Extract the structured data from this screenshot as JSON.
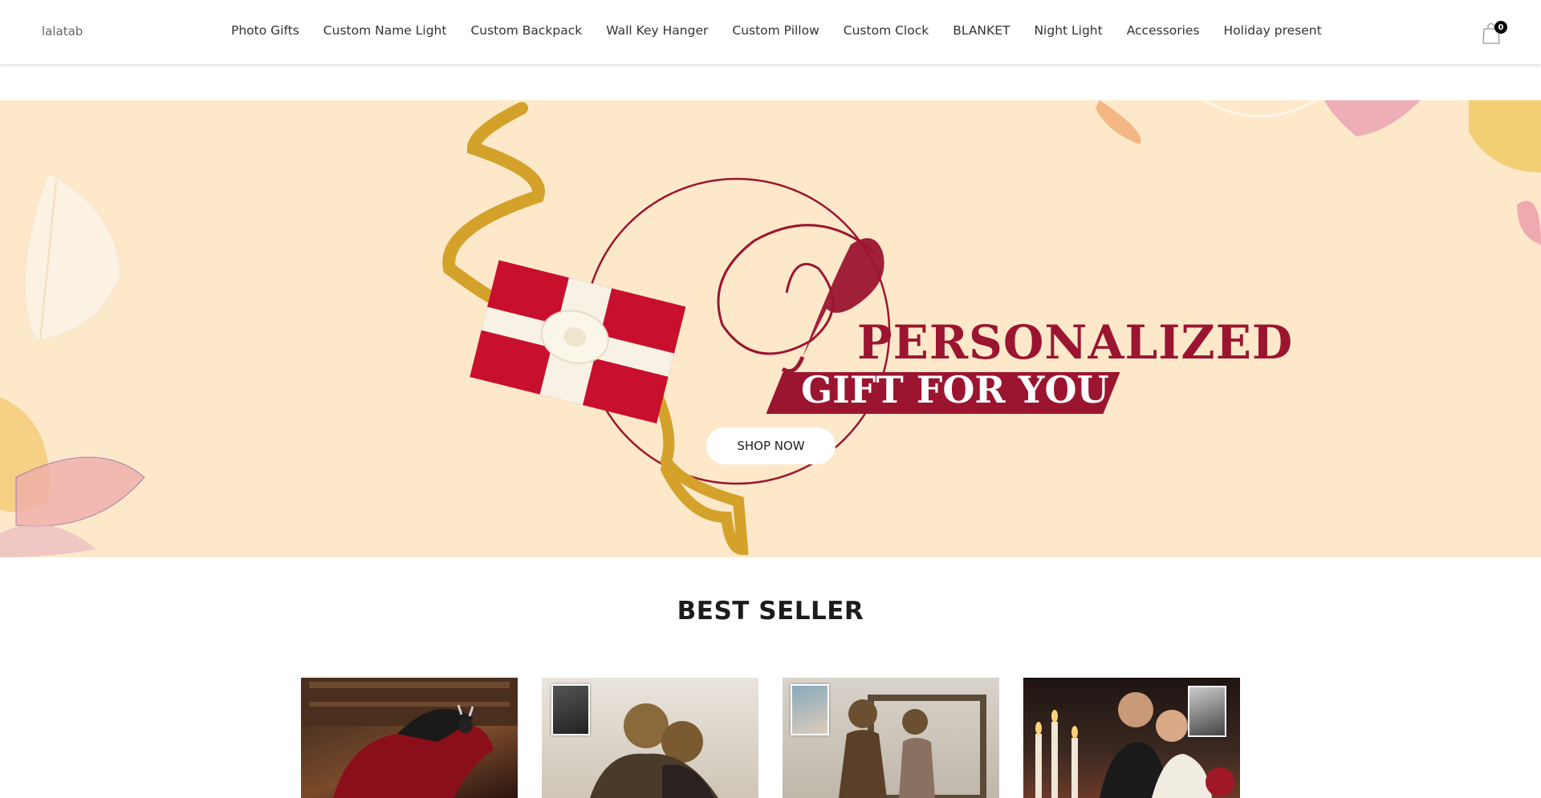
{
  "header": {
    "logo": "lalatab",
    "nav": [
      "Photo Gifts",
      "Custom Name Light",
      "Custom Backpack",
      "Wall Key Hanger",
      "Custom Pillow",
      "Custom Clock",
      "BLANKET",
      "Night Light",
      "Accessories",
      "Holiday present"
    ],
    "cart_count": "0",
    "cart_icon": "shopping-bag-icon"
  },
  "hero": {
    "title": "PERSONALIZED",
    "subtitle": "GIFT FOR YOU",
    "button": "SHOP NOW",
    "colors": {
      "background": "#fde9ca",
      "accent": "#9c1530",
      "ribbon": "#d4a22a"
    }
  },
  "best_seller": {
    "title": "BEST SELLER"
  }
}
